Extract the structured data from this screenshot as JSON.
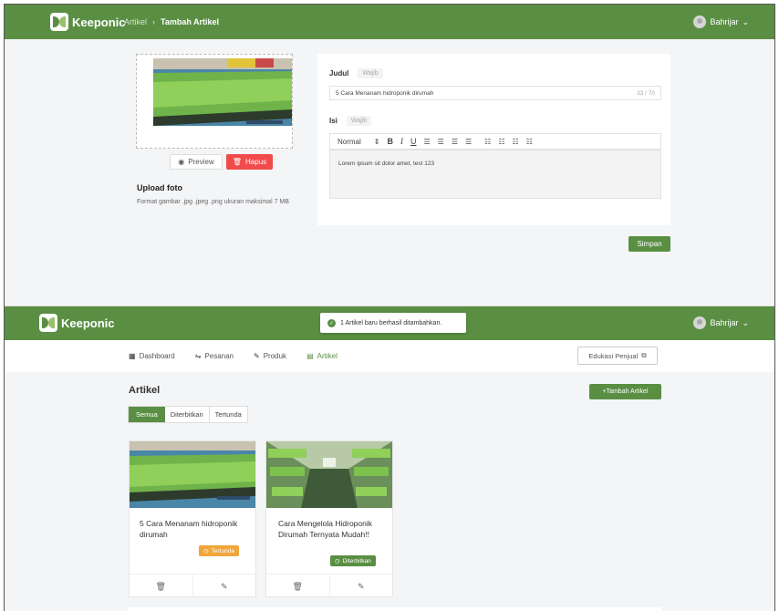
{
  "form_page": {
    "app_name": "Keeponic",
    "breadcrumb": {
      "parent": "Artikel",
      "separator": "›",
      "current": "Tambah Artikel"
    },
    "user": {
      "name": "Bahrijar"
    },
    "preview_button": "Preview",
    "delete_button": "Hapus",
    "upload_title": "Upload foto",
    "upload_hint": "Format gambar .jpg .jpeg .png ukuran maksimal 7 MB",
    "title_label": "Judul",
    "title_required": "Wajib",
    "title_value": "5 Cara Menanam hidroponik dirumah",
    "title_counter": "33 / 70",
    "content_label": "Isi",
    "content_required": "Wajib",
    "toolbar": {
      "format": "Normal",
      "format_arrow": "⇕"
    },
    "content_value": "Lorem ipsum sit dolor amet, test 123",
    "save_button": "Simpan"
  },
  "list_page": {
    "app_name": "Keeponic",
    "toast": "1 Artikel baru berhasil ditambahkan.",
    "user": {
      "name": "Bahrijar"
    },
    "nav": [
      {
        "label": "Dashboard",
        "icon": "dashboard-icon"
      },
      {
        "label": "Pesanan",
        "icon": "orders-icon"
      },
      {
        "label": "Produk",
        "icon": "pencil-icon"
      },
      {
        "label": "Artikel",
        "icon": "article-icon"
      }
    ],
    "seller_edu_button": "Edukasi Penjual",
    "section_title": "Artikel",
    "add_button": "+Tambah Artikel",
    "tabs": [
      "Semua",
      "Diterbitkan",
      "Tertunda"
    ],
    "articles": [
      {
        "title": "5 Cara Menanam hidroponik dirumah",
        "status": "Tertunda",
        "status_color": "#f0a63a"
      },
      {
        "title": "Cara Mengelola Hidroponik Dirumah Ternyata Mudah!!",
        "status": "Diterbitkan",
        "status_color": "#5a8f43"
      }
    ]
  },
  "colors": {
    "brand_green": "#5a8f43",
    "danger_red": "#f24b4b",
    "warning_orange": "#f0a63a"
  }
}
